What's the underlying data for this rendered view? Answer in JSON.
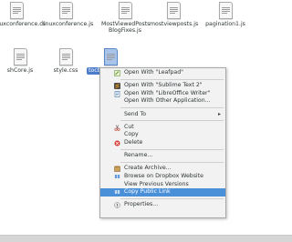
{
  "files": {
    "row1": [
      {
        "name": "linuxconference.cs"
      },
      {
        "name": "linuxconference.js"
      },
      {
        "name": "MostViewedPosts\nBlogFixes.js"
      },
      {
        "name": "mostviewposts.js"
      },
      {
        "name": "pagination1.js"
      }
    ],
    "row2": [
      {
        "name": "shCore.js"
      },
      {
        "name": "style.css"
      },
      {
        "name": "tocbyarchives.js"
      }
    ]
  },
  "menu": {
    "open_leafpad": "Open With \"Leafpad\"",
    "open_sublime": "Open With \"Sublime Text 2\"",
    "open_libreoffice": "Open With \"LibreOffice Writer\"",
    "open_other": "Open With Other Application...",
    "send_to": "Send To",
    "cut": "Cut",
    "copy": "Copy",
    "delete": "Delete",
    "rename": "Rename...",
    "create_archive": "Create Archive...",
    "browse_dropbox": "Browse on Dropbox Website",
    "view_versions": "View Previous Versions",
    "copy_public_link": "Copy Public Link",
    "properties": "Properties..."
  },
  "colors": {
    "highlight": "#4a90d9",
    "selection": "#4a7cc9"
  },
  "icons": {
    "leafpad": "leafpad-icon",
    "sublime": "sublime-icon",
    "libreoffice": "libreoffice-writer-icon",
    "cut": "scissors-icon",
    "delete": "delete-icon",
    "archive": "archive-icon",
    "dropbox": "dropbox-icon",
    "properties": "properties-icon"
  }
}
